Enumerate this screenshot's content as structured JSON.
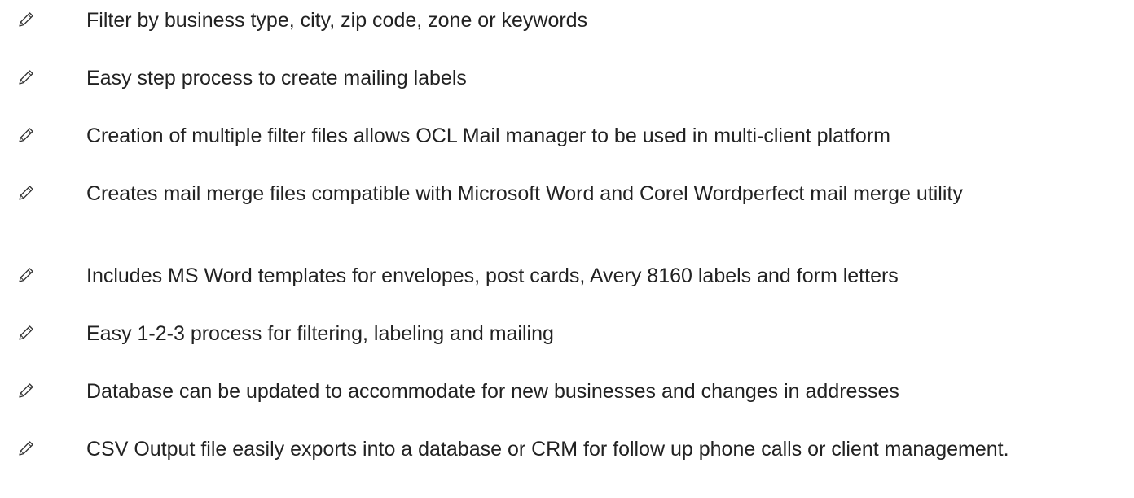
{
  "bullet_icon": "pencil-icon",
  "text_color": "#222222",
  "features": [
    {
      "text": "Filter by business type, city, zip code, zone or keywords"
    },
    {
      "text": "Easy step process to create mailing labels"
    },
    {
      "text": "Creation of multiple filter files allows OCL Mail manager to be used in multi-client platform"
    },
    {
      "text": "Creates mail merge files compatible with Microsoft Word and Corel Wordperfect mail merge utility"
    },
    {
      "text": "Includes MS Word templates for envelopes, post cards, Avery 8160 labels and form letters"
    },
    {
      "text": "Easy 1-2-3 process for filtering, labeling and mailing"
    },
    {
      "text": "Database can be updated to accommodate for new businesses and changes in addresses"
    },
    {
      "text": "CSV Output file easily exports into a database or CRM for follow up phone calls or client management."
    }
  ]
}
